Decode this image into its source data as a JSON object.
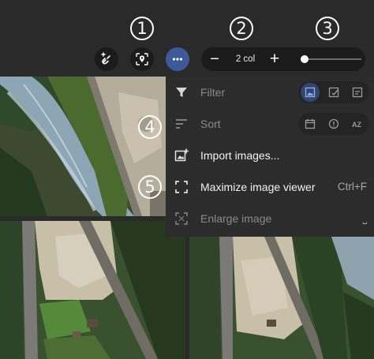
{
  "callouts": [
    "1",
    "2",
    "3",
    "4",
    "5"
  ],
  "toolbar": {
    "columns": {
      "minus": "−",
      "value": "2 col",
      "plus": "+"
    },
    "size_slider": {
      "value": 0.05
    }
  },
  "menu": {
    "filter": {
      "label": "Filter"
    },
    "sort": {
      "label": "Sort"
    },
    "import": {
      "label": "Import images..."
    },
    "maximize": {
      "label": "Maximize image viewer",
      "shortcut": "Ctrl+F"
    },
    "enlarge": {
      "label": "Enlarge image",
      "shortcut": "⎵"
    }
  },
  "colors": {
    "accent": "#3c5a9a",
    "panel": "#2c2c2c",
    "toolbar": "#2a2a2a"
  }
}
